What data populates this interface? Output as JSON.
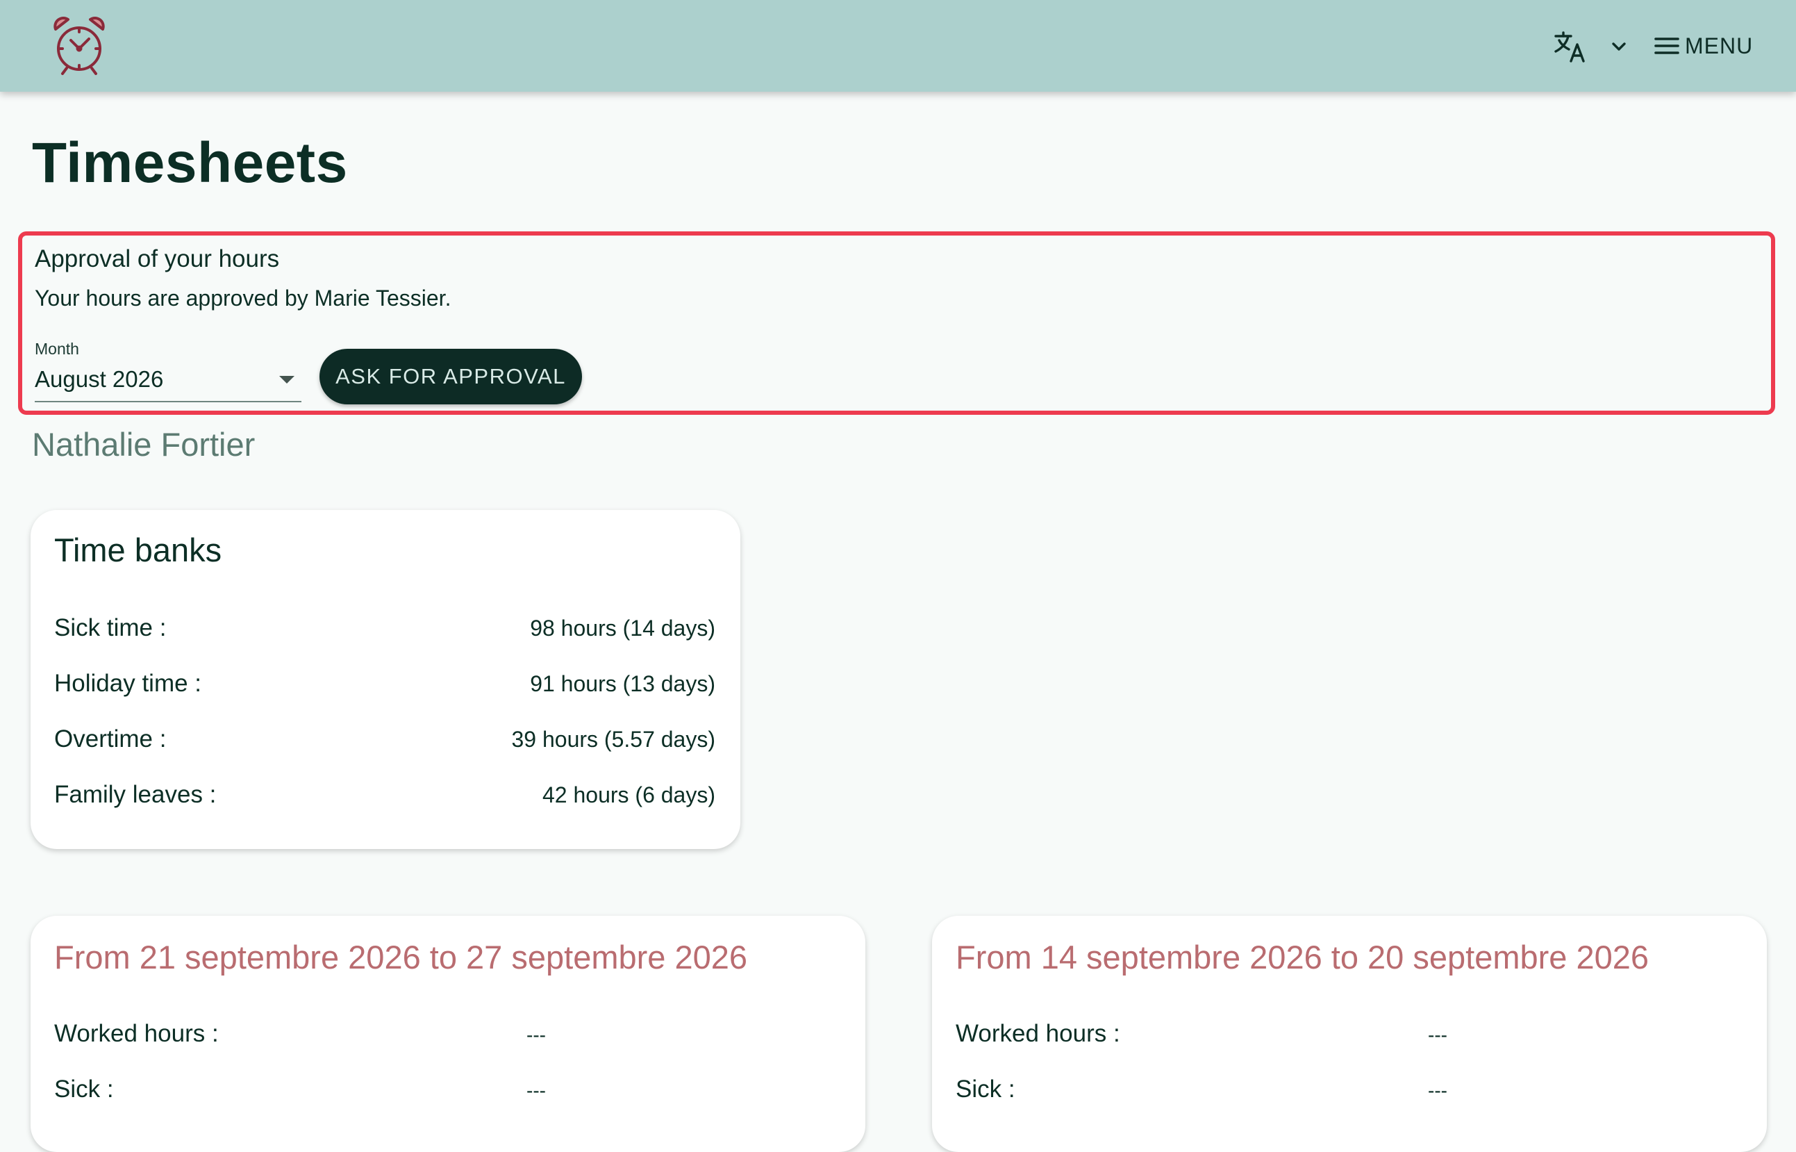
{
  "appbar": {
    "logo_icon": "alarm-clock-icon",
    "language_icon": "translate-icon",
    "language_dropdown_icon": "chevron-down-icon",
    "menu_icon": "hamburger-icon",
    "menu_label": "MENU",
    "colors": {
      "bar": "#acd0cd",
      "logo": "#8a2a3a"
    }
  },
  "page": {
    "title": "Timesheets"
  },
  "approval": {
    "title": "Approval of your hours",
    "text": "Your hours are approved by Marie Tessier.",
    "month_label": "Month",
    "month_value": "August 2026",
    "button_label": "ASK FOR APPROVAL",
    "highlight_color": "#ed3b4f"
  },
  "employee": {
    "name": "Nathalie Fortier"
  },
  "time_banks": {
    "title": "Time banks",
    "rows": [
      {
        "label": "Sick time :",
        "value": "98 hours (14 days)"
      },
      {
        "label": "Holiday time :",
        "value": "91 hours (13 days)"
      },
      {
        "label": "Overtime :",
        "value": "39 hours (5.57 days)"
      },
      {
        "label": "Family leaves :",
        "value": "42 hours (6 days)"
      }
    ]
  },
  "weeks": [
    {
      "title": "From 21 septembre 2026 to 27 septembre 2026",
      "rows": [
        {
          "label": "Worked hours :",
          "value": "---"
        },
        {
          "label": "Sick :",
          "value": "---"
        }
      ]
    },
    {
      "title": "From 14 septembre 2026 to 20 septembre 2026",
      "rows": [
        {
          "label": "Worked hours :",
          "value": "---"
        },
        {
          "label": "Sick :",
          "value": "---"
        }
      ]
    }
  ]
}
